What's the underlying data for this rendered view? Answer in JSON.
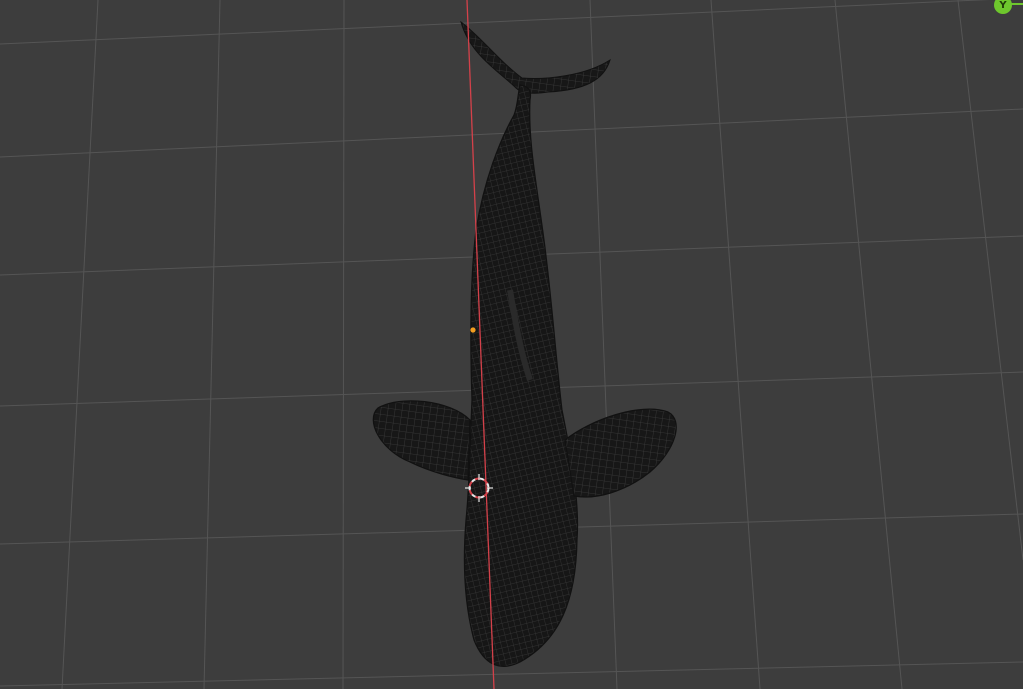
{
  "viewport": {
    "background": "#3d3d3d",
    "grid_color": "#555555",
    "x_axis_color": "#d4414a",
    "mesh_color": "#151515",
    "wire_color": "#3a3a3a",
    "cursor_colors": [
      "#e8e8e8",
      "#d4414a"
    ],
    "origin_color": "#f29d1f",
    "object_icon": "whale-mesh-icon"
  },
  "gizmo": {
    "y_label": "Y",
    "y_color": "#6ec72d",
    "icon": "axis-y-icon"
  }
}
